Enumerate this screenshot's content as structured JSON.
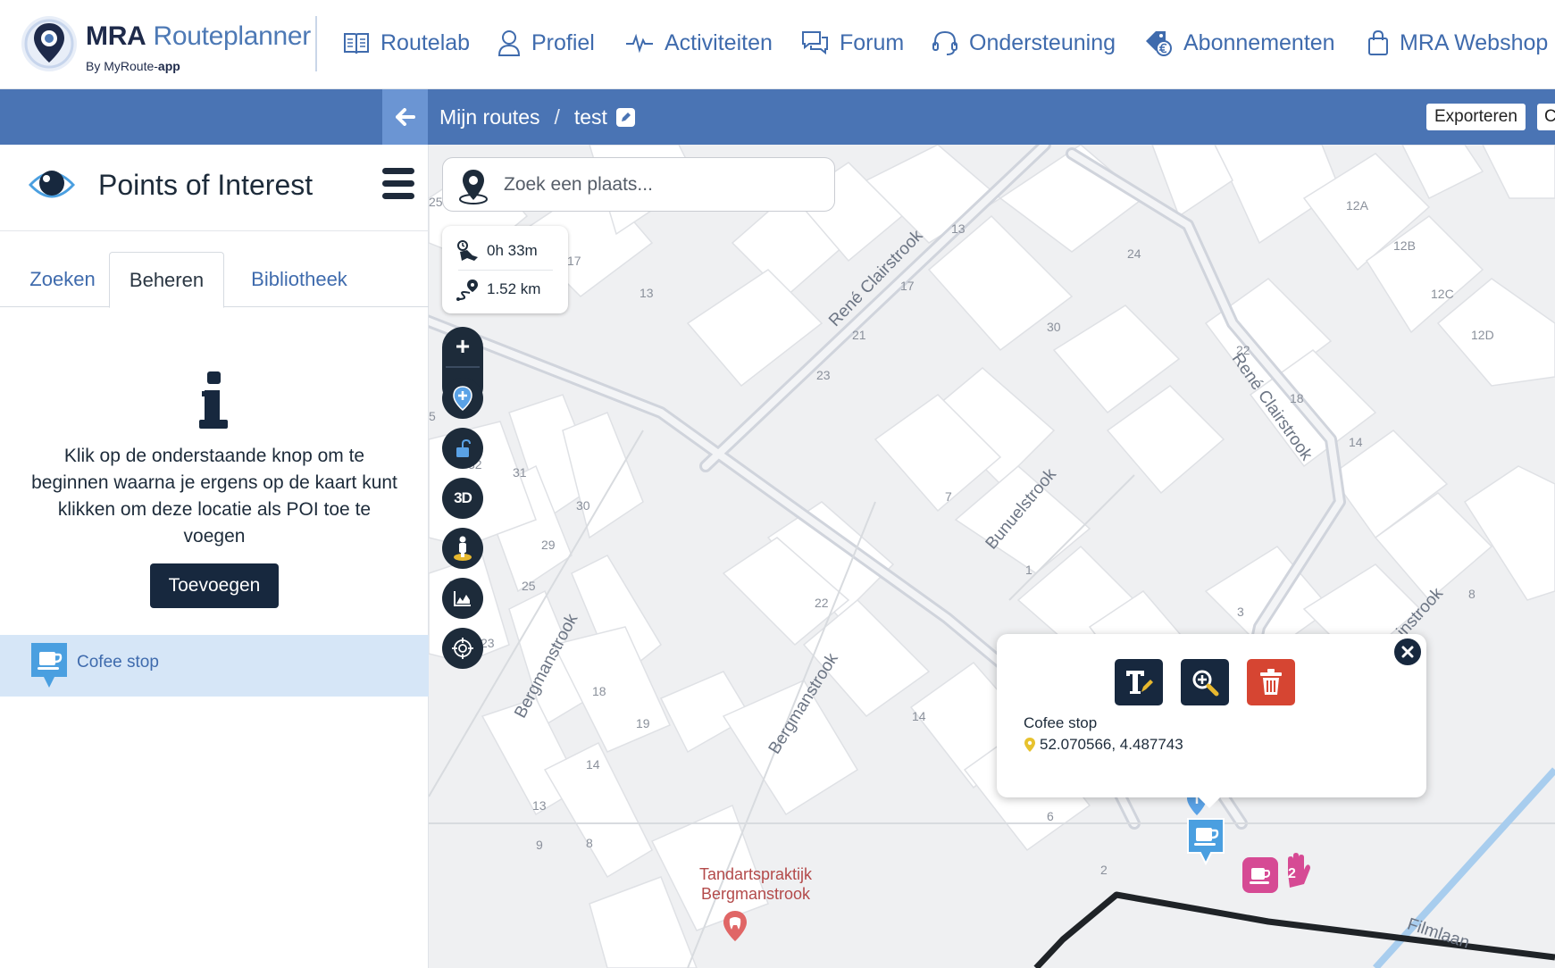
{
  "app": {
    "logo_brand": "MRA",
    "logo_name": "Routeplanner",
    "logo_sub_by": "By MyRoute-",
    "logo_sub_app": "app"
  },
  "nav": {
    "items": [
      {
        "label": "Routelab",
        "icon": "book-icon"
      },
      {
        "label": "Profiel",
        "icon": "user-icon"
      },
      {
        "label": "Activiteiten",
        "icon": "pulse-icon"
      },
      {
        "label": "Forum",
        "icon": "chat-icon"
      },
      {
        "label": "Ondersteuning",
        "icon": "headset-icon"
      },
      {
        "label": "Abonnementen",
        "icon": "euro-tag-icon"
      },
      {
        "label": "MRA Webshop",
        "icon": "shopping-bag-icon"
      }
    ]
  },
  "header": {
    "breadcrumb_root": "Mijn routes",
    "breadcrumb_sep": "/",
    "breadcrumb_current": "test",
    "export_label": "Exporteren",
    "extra_label": "C",
    "accent_color": "#4a74b4"
  },
  "panel": {
    "title": "Points of Interest",
    "tabs": [
      {
        "label": "Zoeken"
      },
      {
        "label": "Beheren"
      },
      {
        "label": "Bibliotheek"
      }
    ],
    "active_tab": "Beheren",
    "info_text": "Klik op de onderstaande knop om te beginnen waarna je ergens op de kaart kunt klikken om deze locatie als POI toe te voegen",
    "add_button": "Toevoegen",
    "poi_list": [
      {
        "name": "Cofee stop",
        "icon": "coffee-pin-icon"
      }
    ]
  },
  "map": {
    "search_placeholder": "Zoek een plaats...",
    "duration": "0h 33m",
    "distance": "1.52 km",
    "zoom_in": "+",
    "zoom_out": "−",
    "btn_3d": "3D",
    "streets": [
      "René Clairstrook",
      "René Clairstrook",
      "Bunuelstrook",
      "Bergmanstrook",
      "Bergmanstrook",
      "Filmlaan",
      "instrook"
    ],
    "house_numbers": [
      "25",
      "17",
      "13",
      "13",
      "17",
      "21",
      "23",
      "24",
      "30",
      "12A",
      "12B",
      "12C",
      "12D",
      "22",
      "18",
      "14",
      "5",
      "32",
      "31",
      "30",
      "29",
      "25",
      "21",
      "23",
      "7",
      "1",
      "3",
      "8",
      "22",
      "18",
      "19",
      "14",
      "14",
      "13",
      "9",
      "8",
      "6",
      "2"
    ],
    "poi_label": "Tandartspraktijk Bergmanstrook",
    "marker_count": "2"
  },
  "popup": {
    "name": "Cofee stop",
    "coords": "52.070566, 4.487743",
    "buttons": [
      "rename-button",
      "zoom-button",
      "delete-button"
    ],
    "delete_color": "#d64532",
    "button_color": "#17283e"
  }
}
